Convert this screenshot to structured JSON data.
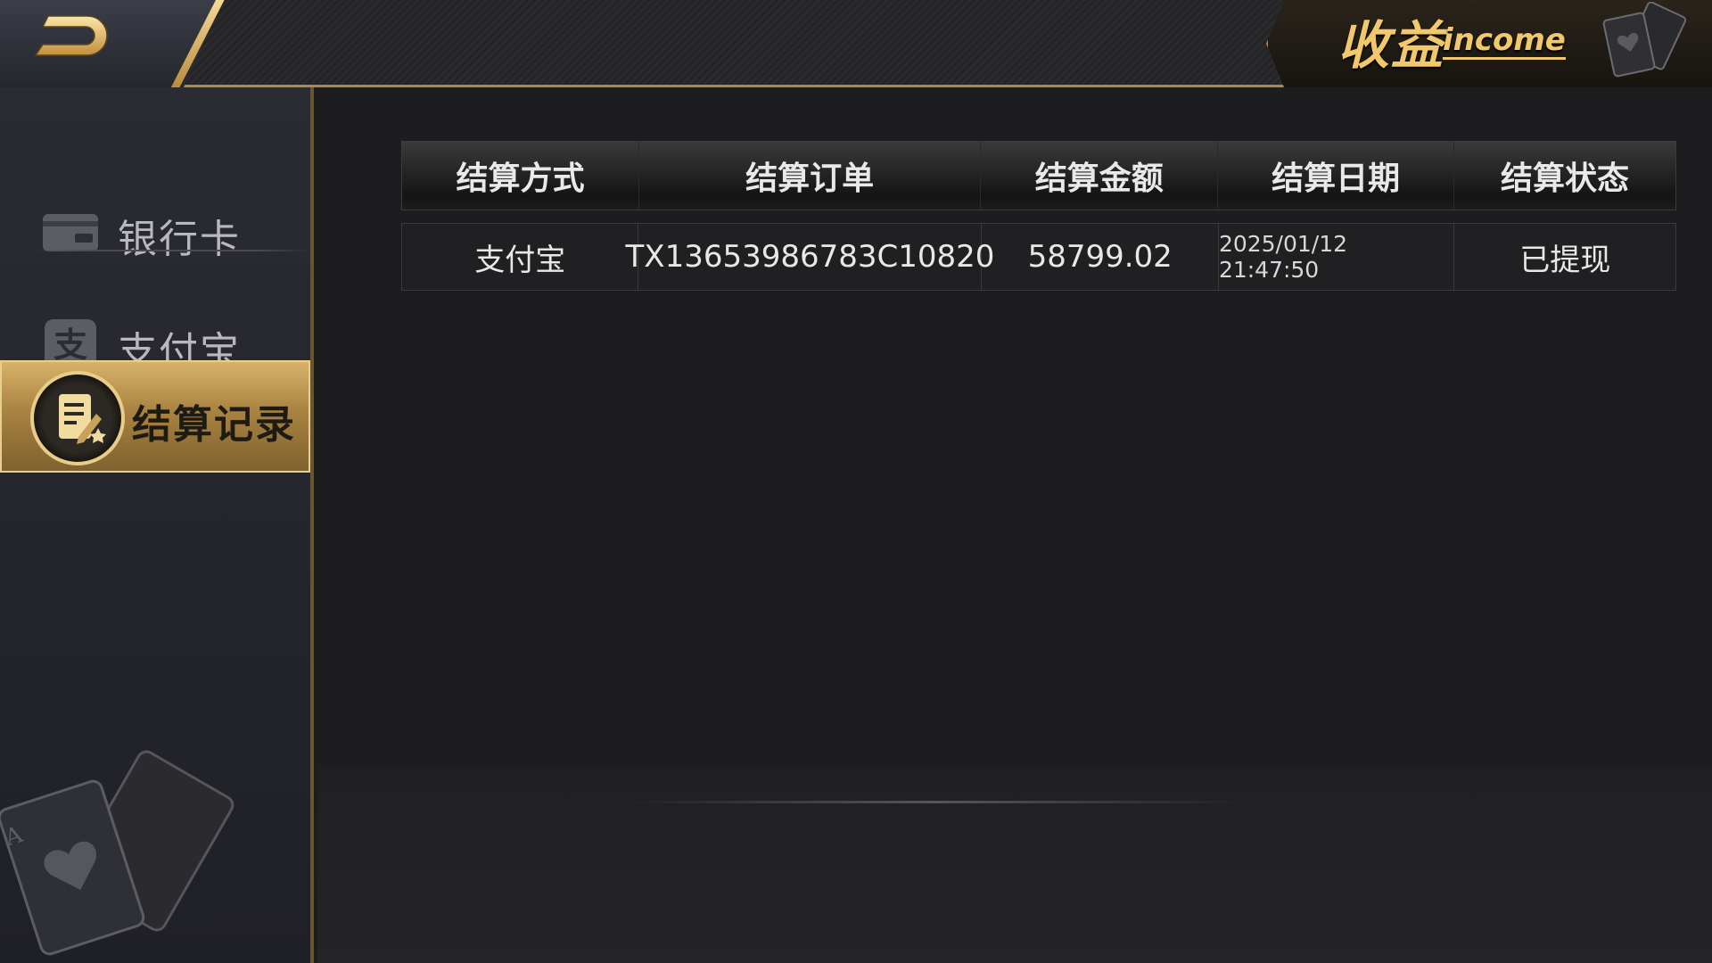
{
  "header": {
    "title_cn": "收益",
    "title_en": "income",
    "back_icon": "back-arrow-icon"
  },
  "sidebar": {
    "items": [
      {
        "label": "银行卡",
        "icon": "bank-card-icon",
        "active": false
      },
      {
        "label": "支付宝",
        "icon": "alipay-icon",
        "active": false
      },
      {
        "label": "结算记录",
        "icon": "settlement-record-icon",
        "active": true
      }
    ]
  },
  "table": {
    "columns": [
      "结算方式",
      "结算订单",
      "结算金额",
      "结算日期",
      "结算状态"
    ],
    "rows": [
      {
        "method": "支付宝",
        "order": "TX13653986783C10820",
        "amount": "58799.02",
        "date": "2025/01/12 21:47:50",
        "status": "已提现"
      }
    ]
  },
  "colors": {
    "gold": "#f2c86d",
    "gold_border": "#a98a4a",
    "background": "#1d1d1f",
    "sidebar": "#26272e"
  }
}
